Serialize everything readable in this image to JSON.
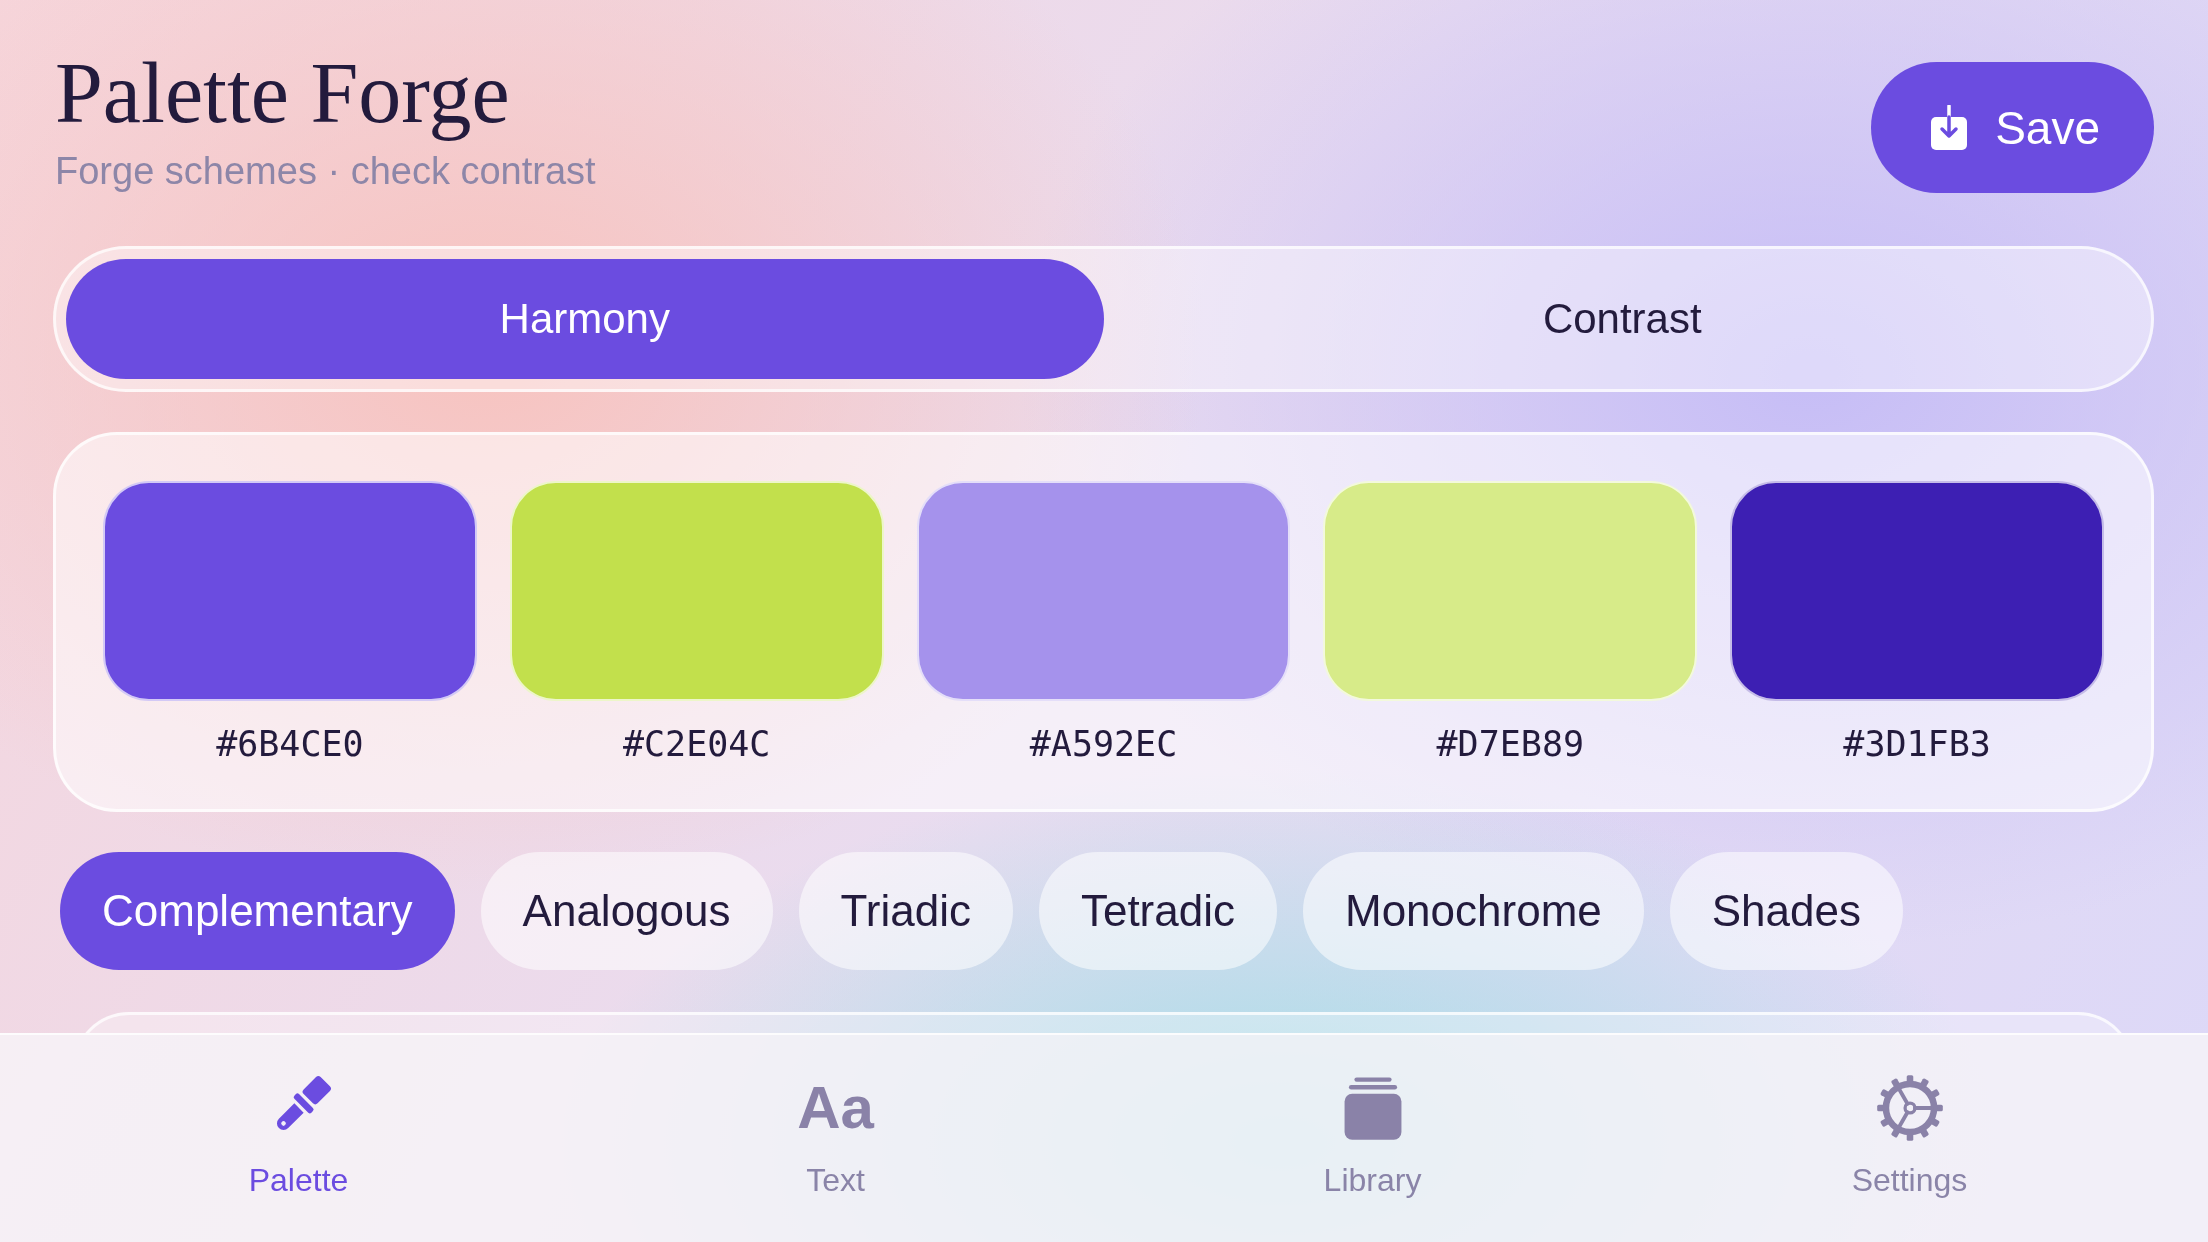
{
  "header": {
    "title": "Palette Forge",
    "subtitle": "Forge schemes · check contrast",
    "save_button": {
      "label": "Save"
    }
  },
  "mode_tabs": [
    {
      "label": "Harmony",
      "selected": true
    },
    {
      "label": "Contrast",
      "selected": false
    }
  ],
  "swatches": [
    {
      "hex": "#6B4CE0",
      "color": "#6b4ce0"
    },
    {
      "hex": "#C2E04C",
      "color": "#c2e04c"
    },
    {
      "hex": "#A592EC",
      "color": "#a592ec"
    },
    {
      "hex": "#D7EB89",
      "color": "#d7eb89"
    },
    {
      "hex": "#3D1FB3",
      "color": "#3d1fb3"
    }
  ],
  "schemes": [
    {
      "label": "Complementary",
      "selected": true
    },
    {
      "label": "Analogous",
      "selected": false
    },
    {
      "label": "Triadic",
      "selected": false
    },
    {
      "label": "Tetradic",
      "selected": false
    },
    {
      "label": "Monochrome",
      "selected": false
    },
    {
      "label": "Shades",
      "selected": false
    }
  ],
  "tab_bar": [
    {
      "label": "Palette",
      "selected": true
    },
    {
      "label": "Text",
      "selected": false,
      "icon_text": "Aa"
    },
    {
      "label": "Library",
      "selected": false
    },
    {
      "label": "Settings",
      "selected": false
    }
  ]
}
